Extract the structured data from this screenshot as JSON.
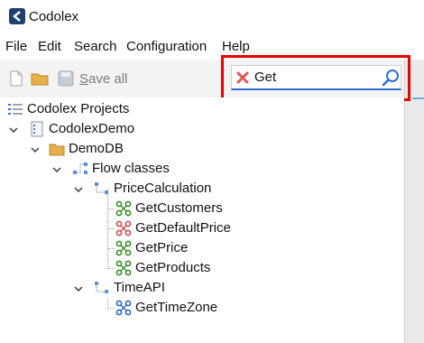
{
  "window": {
    "title": "Codolex"
  },
  "menu": [
    "File",
    "Edit",
    "Search",
    "Configuration",
    "Help"
  ],
  "toolbar": {
    "save_all_prefix": "S",
    "save_all_rest": "ave all"
  },
  "search": {
    "value": "Get"
  },
  "colors": {
    "highlight": "#e60000",
    "accent": "#2f6fd1",
    "flow_icon_green": "#3a8a2a",
    "flow_icon_red": "#d04a4a",
    "flow_icon_blue": "#2a64c8"
  },
  "tree": {
    "root": "Codolex Projects",
    "project": "CodolexDemo",
    "database": "DemoDB",
    "group": "Flow classes",
    "classes": [
      {
        "name": "PriceCalculation",
        "methods": [
          {
            "name": "GetCustomers",
            "icon": "flow-green-icon"
          },
          {
            "name": "GetDefaultPrice",
            "icon": "flow-red-icon"
          },
          {
            "name": "GetPrice",
            "icon": "flow-green-icon"
          },
          {
            "name": "GetProducts",
            "icon": "flow-green-icon"
          }
        ]
      },
      {
        "name": "TimeAPI",
        "methods": [
          {
            "name": "GetTimeZone",
            "icon": "flow-blue-icon"
          }
        ]
      }
    ]
  }
}
